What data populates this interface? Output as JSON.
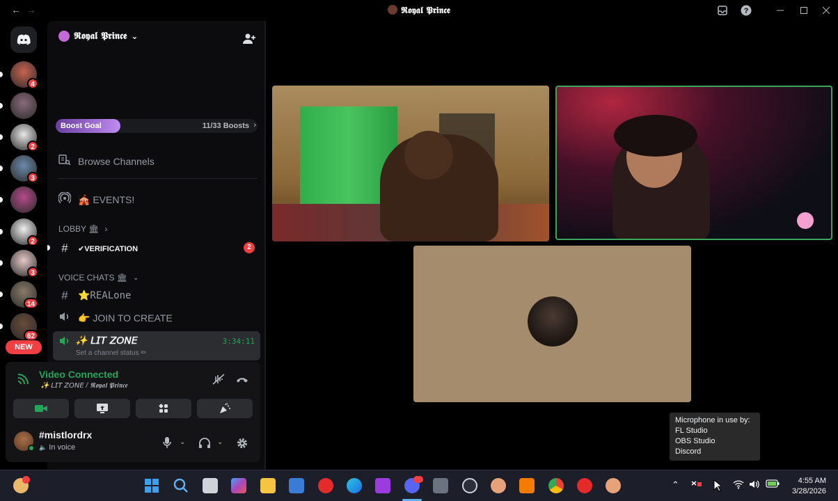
{
  "window": {
    "title": "𝕽𝖔𝖞𝖆𝖑 𝕻𝖗𝖎𝖓𝖈𝖊",
    "back_glyph": "←",
    "forward_glyph": "→"
  },
  "servers": [
    {
      "badge": "4"
    },
    {
      "badge": ""
    },
    {
      "badge": "2"
    },
    {
      "badge": "3"
    },
    {
      "badge": ""
    },
    {
      "badge": "2"
    },
    {
      "badge": "3"
    },
    {
      "badge": "14"
    },
    {
      "badge": "62"
    }
  ],
  "rail": {
    "new_label": "NEW"
  },
  "server_header": {
    "name": "𝕽𝖔𝖞𝖆𝖑 𝕻𝖗𝖎𝖓𝖈𝖊",
    "chevron": "⌄"
  },
  "boost": {
    "label": "Boost Goal",
    "count": "11/33 Boosts",
    "chevron": "›",
    "progress_fraction": 0.333
  },
  "channels": {
    "browse": "Browse Channels",
    "events": "🎪 EVENTS!",
    "lobby_category": "LOBBY 🏛",
    "verification": "✔VERIFICATION",
    "verification_mentions": "2",
    "voice_category": "VOICE CHATS 🏛",
    "realone": "⭐REALone",
    "join_to_create": "👉 JOIN TO CREATE",
    "active_voice": "✨ 𝘓𝘐𝘛 𝘡𝘖𝘕𝘌",
    "active_status": "Set a channel status ✏",
    "active_timer": "3:34:11"
  },
  "voice": {
    "connected_label": "Video Connected",
    "location": "✨ 𝘓𝘐𝘛 𝘡𝘖𝘕𝘌 / 𝕽𝖔𝖞𝖆𝖑 𝕻𝖗𝖎𝖓𝖈𝖊"
  },
  "user": {
    "name": "#mistlordrx",
    "status": "In voice"
  },
  "tooltip": {
    "line1": "Microphone in use by:",
    "line2": "FL Studio",
    "line3": "OBS Studio",
    "line4": "Discord"
  },
  "clock": {
    "time": "4:55 AM",
    "date": "3/28/2026"
  },
  "colors": {
    "accent_green": "#23a55a",
    "mention_red": "#f23f43",
    "speaking_border": "#3ba55d"
  }
}
